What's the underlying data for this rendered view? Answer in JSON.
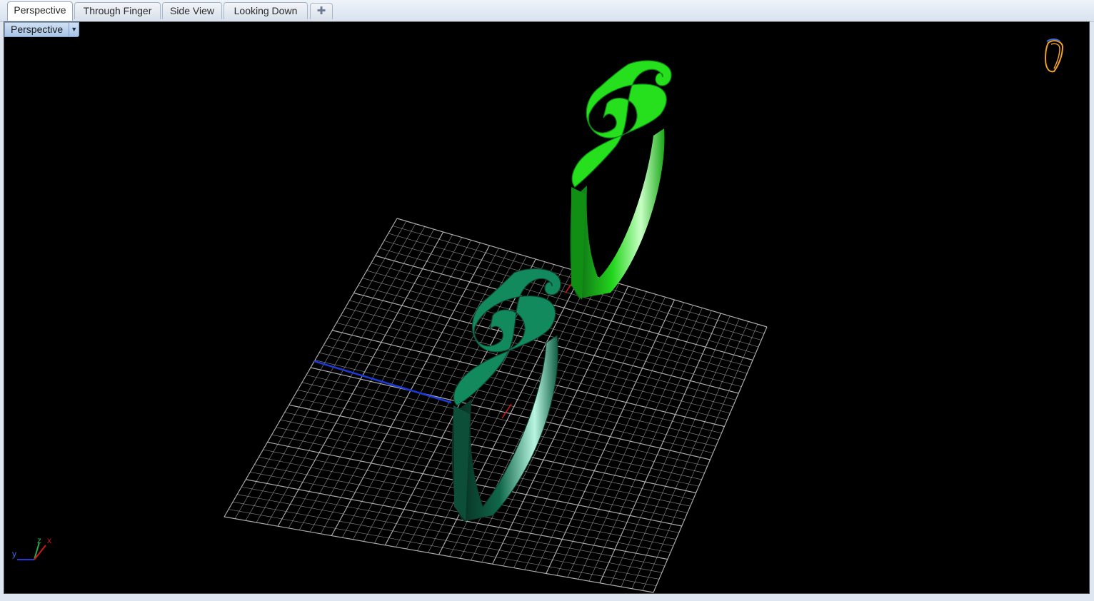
{
  "tabs": [
    {
      "label": "Perspective",
      "active": true
    },
    {
      "label": "Through Finger",
      "active": false
    },
    {
      "label": "Side View",
      "active": false
    },
    {
      "label": "Looking Down",
      "active": false
    }
  ],
  "add_tab_icon": "plus-icon",
  "viewport": {
    "label": "Perspective",
    "dropdown_icon": "triangle-down-icon",
    "background": "#000000",
    "grid_color": "#bdbdbd",
    "axis_colors": {
      "x": "#d01818",
      "y": "#1a3bd8",
      "z": "#2ea84a"
    },
    "gizmo_labels": {
      "x": "x",
      "y": "y",
      "z": "z"
    },
    "objects": [
      {
        "name": "selected ring with treble clef",
        "color": "#22e01c"
      },
      {
        "name": "ring with treble clef",
        "color": "#137a52"
      }
    ],
    "nav_widget_color": "#f0a020"
  }
}
